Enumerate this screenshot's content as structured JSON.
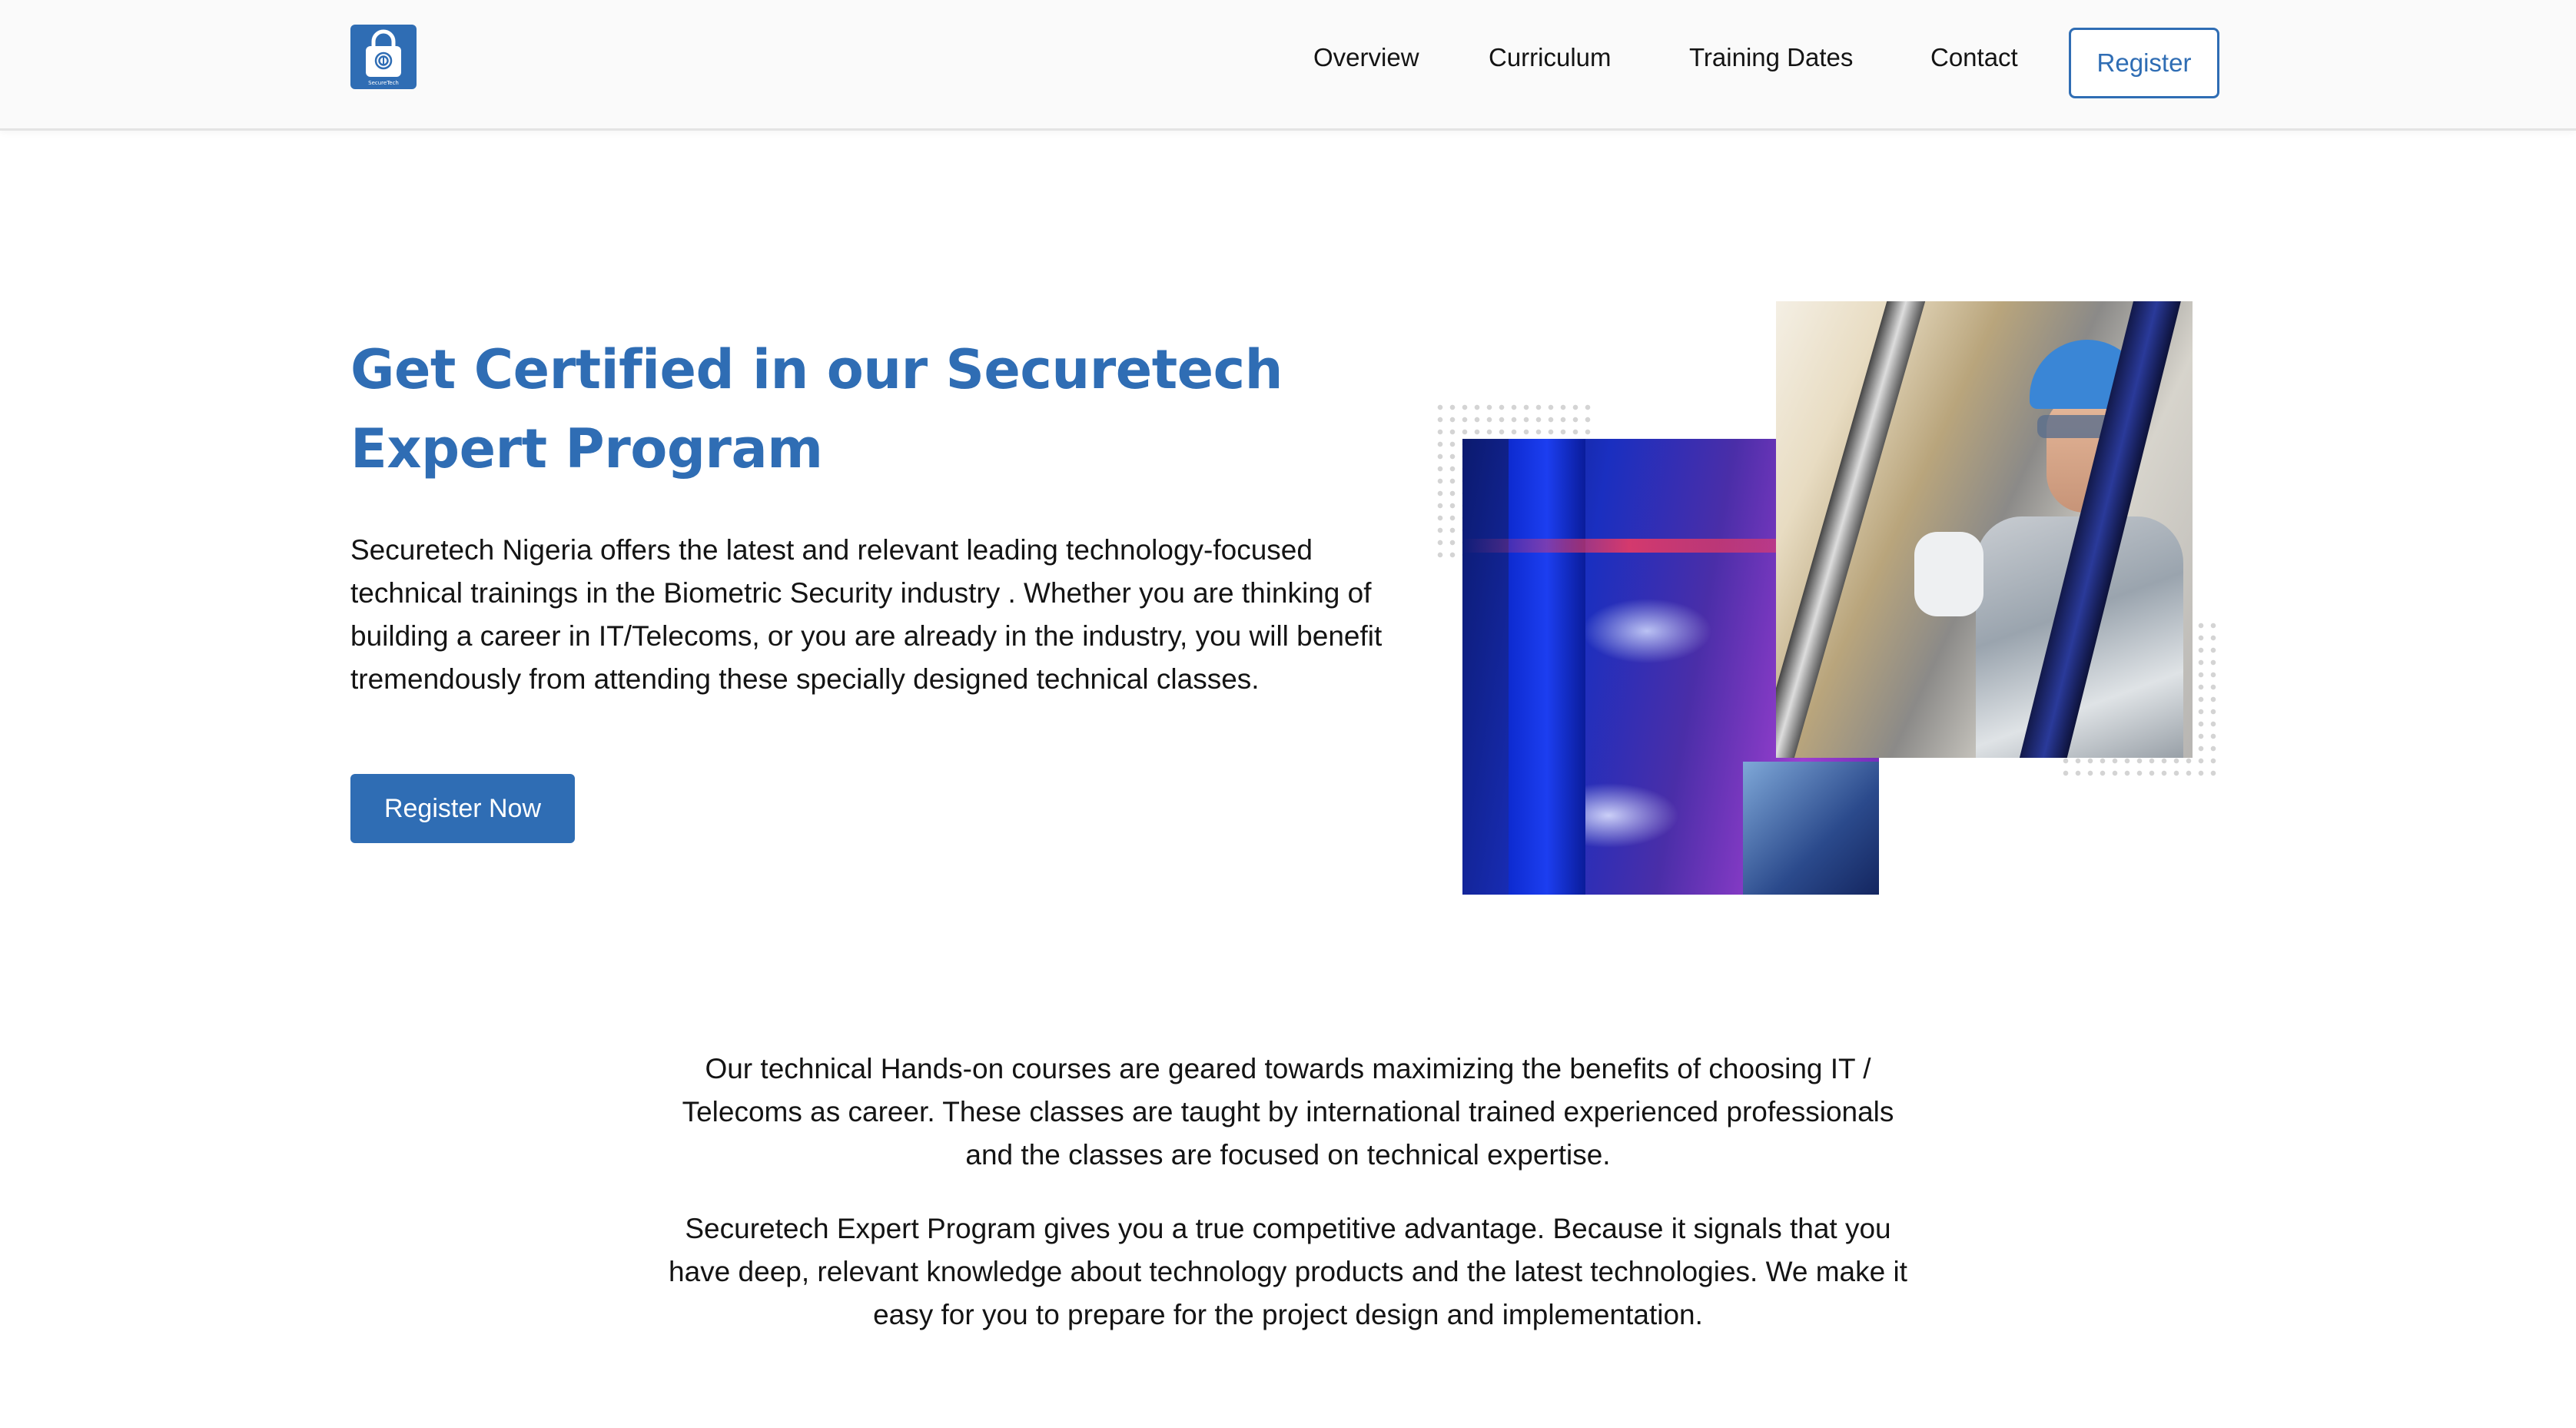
{
  "header": {
    "logo": {
      "icon": "padlock-fingerprint-icon",
      "text": "SecureTech"
    },
    "nav": [
      "Overview",
      "Curriculum",
      "Training Dates",
      "Contact"
    ],
    "register_label": "Register"
  },
  "hero": {
    "title": "Get Certified in our Securetech Expert Program",
    "description": "Securetech Nigeria offers the latest and relevant leading technology-focused technical trainings in the Biometric Security industry . Whether you are thinking of building a career in IT/Telecoms, or you are already in the industry, you will benefit tremendously from attending these specially designed technical classes.",
    "cta_label": "Register Now",
    "images": [
      "security-cameras-photo",
      "technician-photo"
    ]
  },
  "intro": {
    "paragraph_1": "Our technical Hands-on courses are geared towards maximizing the benefits of choosing IT / Telecoms as career. These classes are taught by international trained experienced professionals and the classes are focused on technical expertise.",
    "paragraph_2": "Securetech Expert Program gives you a true competitive advantage. Because it signals that you have deep, relevant knowledge about technology products and the latest technologies. We make it easy for you to prepare for the project design and implementation."
  },
  "colors": {
    "brand": "#2f6db4",
    "text": "#141414",
    "header_bg": "#fafafa"
  }
}
